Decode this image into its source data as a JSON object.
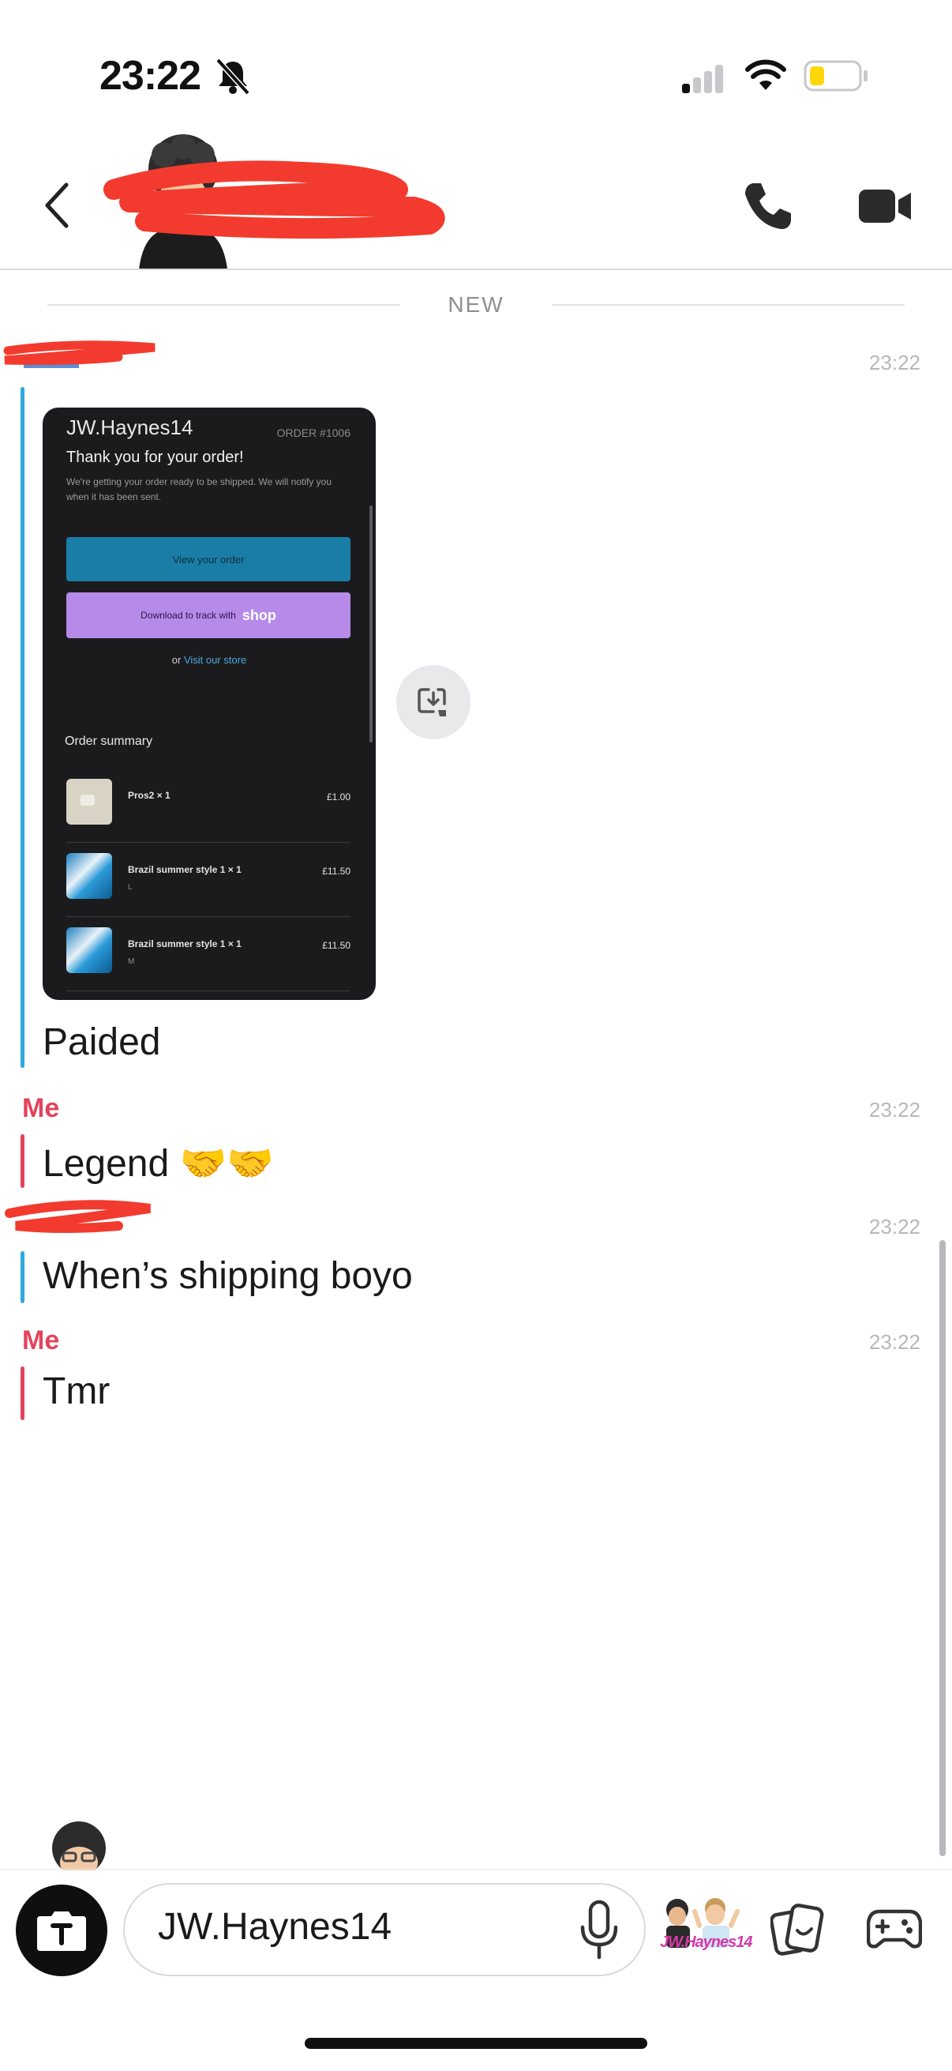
{
  "status_bar": {
    "time": "23:22"
  },
  "divider": {
    "new_label": "NEW"
  },
  "messages": [
    {
      "sender": "",
      "time": "23:22",
      "text": "Paided"
    },
    {
      "sender": "Me",
      "time": "23:22",
      "text": "Legend 🤝🤝"
    },
    {
      "sender": "",
      "time": "23:22",
      "text": "When’s shipping boyo"
    },
    {
      "sender": "Me",
      "time": "23:22",
      "text": "Tmr"
    }
  ],
  "receipt": {
    "shop_name": "JW.Haynes14",
    "order_number": "ORDER #1006",
    "thanks": "Thank you for your order!",
    "subtitle": "We're getting your order ready to be shipped. We will notify you when it has been sent.",
    "view_button": "View your order",
    "track_prefix": "Download to track with",
    "track_brand": "shop",
    "visit_prefix": "or",
    "visit_link": "Visit our store",
    "summary_title": "Order summary",
    "items": [
      {
        "name": "Pros2 × 1",
        "variant": "",
        "price": "£1.00"
      },
      {
        "name": "Brazil summer style 1 × 1",
        "variant": "L",
        "price": "£11.50"
      },
      {
        "name": "Brazil summer style 1 × 1",
        "variant": "M",
        "price": "£11.50"
      }
    ]
  },
  "composer": {
    "input_text": "JW.Haynes14",
    "bitmoji_label": "JW.Haynes14"
  },
  "colors": {
    "me": "#e2445c",
    "friend": "#2eaade",
    "timestamp": "#b8b8bc",
    "redaction": "#f23b2e"
  }
}
